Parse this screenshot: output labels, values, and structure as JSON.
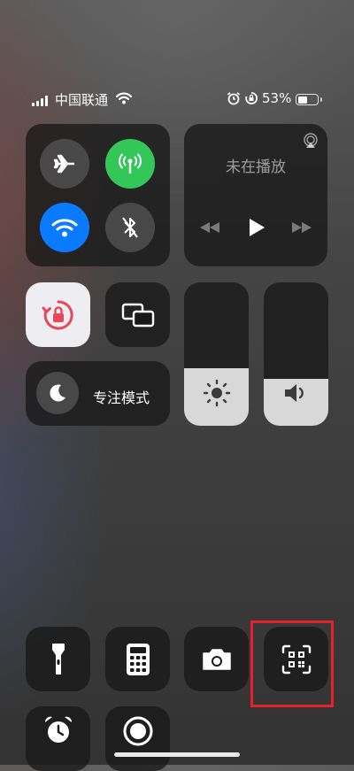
{
  "status_bar": {
    "carrier": "中国联通",
    "battery_percent": "53%",
    "battery_level": 0.53,
    "icons": [
      "signal-icon",
      "wifi-icon",
      "alarm-icon",
      "rotation-lock-icon",
      "battery-icon"
    ]
  },
  "connectivity": {
    "airplane": {
      "icon": "airplane-icon",
      "state": "off"
    },
    "cellular": {
      "icon": "cellular-antenna-icon",
      "state": "on",
      "color": "#33c759"
    },
    "wifi": {
      "icon": "wifi-icon",
      "state": "on",
      "color": "#0a7aff"
    },
    "bluetooth": {
      "icon": "bluetooth-icon",
      "state": "off"
    }
  },
  "now_playing": {
    "title": "未在播放",
    "icons": [
      "airplay-icon",
      "previous-icon",
      "play-icon",
      "next-icon"
    ]
  },
  "controls": {
    "orientation_lock": {
      "icon": "orientation-lock-icon",
      "state": "on",
      "accent": "#e8465a"
    },
    "screen_mirroring": {
      "icon": "screen-mirroring-icon"
    },
    "focus": {
      "label": "专注模式",
      "icon": "moon-icon"
    }
  },
  "sliders": {
    "brightness": {
      "icon": "sun-icon",
      "level": 0.4
    },
    "volume": {
      "icon": "speaker-icon",
      "level": 0.33
    }
  },
  "shortcuts": [
    {
      "name": "flashlight",
      "icon": "flashlight-icon"
    },
    {
      "name": "calculator",
      "icon": "calculator-icon"
    },
    {
      "name": "camera",
      "icon": "camera-icon"
    },
    {
      "name": "qr-scanner",
      "icon": "qr-code-scanner-icon",
      "highlighted": true
    },
    {
      "name": "alarm",
      "icon": "alarm-clock-icon"
    },
    {
      "name": "screen-recording",
      "icon": "screen-record-icon"
    }
  ],
  "highlight_color": "#e8202a"
}
